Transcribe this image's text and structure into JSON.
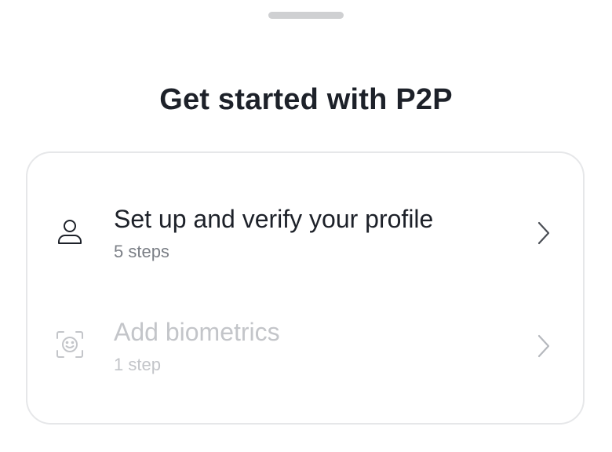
{
  "sheet": {
    "title": "Get started with P2P"
  },
  "steps": [
    {
      "title": "Set up and verify your profile",
      "subtitle": "5 steps",
      "icon": "user-icon",
      "enabled": true
    },
    {
      "title": "Add biometrics",
      "subtitle": "1 step",
      "icon": "face-scan-icon",
      "enabled": false
    }
  ],
  "colors": {
    "text_primary": "#1d2129",
    "text_secondary": "#7b7f86",
    "text_disabled": "#c3c5c9",
    "border": "#e6e7e9",
    "grabber": "#cfd0d2"
  }
}
